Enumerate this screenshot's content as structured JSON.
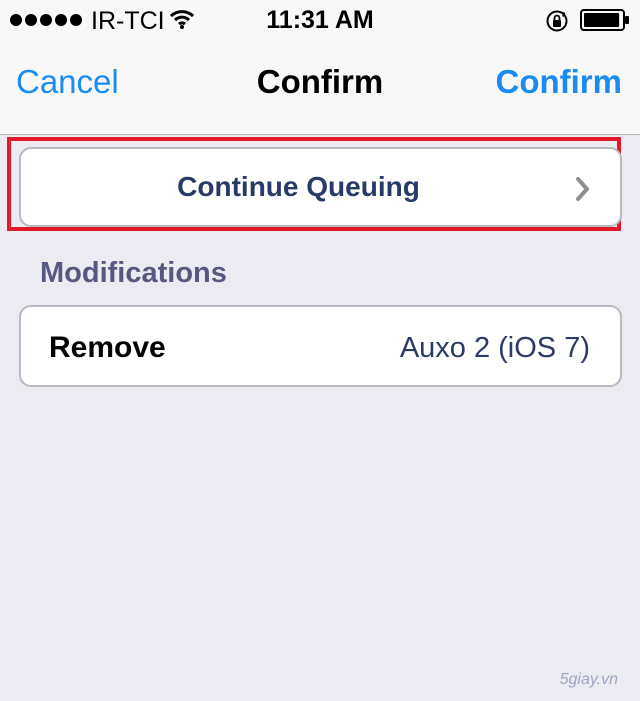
{
  "status_bar": {
    "signal_bars": 5,
    "carrier": "IR-TCI",
    "time": "11:31 AM",
    "icons": [
      "signal-icon",
      "wifi-icon",
      "rotation-lock-icon",
      "battery-icon"
    ],
    "battery_level": 0.95
  },
  "nav": {
    "left_label": "Cancel",
    "title": "Confirm",
    "right_label": "Confirm"
  },
  "continue_cell": {
    "label": "Continue Queuing",
    "accessory_icon": "chevron-right-icon"
  },
  "modifications": {
    "header": "Modifications",
    "rows": [
      {
        "action": "Remove",
        "package": "Auxo 2 (iOS 7)"
      }
    ]
  },
  "watermark": "5giay.vn",
  "colors": {
    "accent": "#1a8cf0",
    "highlight": "#e11a2b",
    "background": "#ebebf1",
    "cell_text": "#283a68"
  }
}
